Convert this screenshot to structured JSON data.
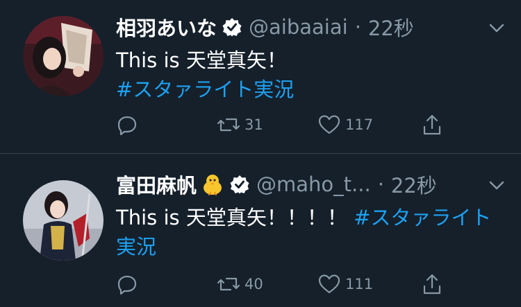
{
  "tweets": [
    {
      "name": "相羽あいな",
      "handle": "@aibaaiai",
      "separator": "·",
      "time": "22秒",
      "emoji": "",
      "text": "This is 天堂真矢！",
      "hashtag": "#スタァライト実況",
      "actions": {
        "reply": "",
        "retweet": "31",
        "like": "117"
      },
      "icons": [
        "reply-icon",
        "retweet-icon",
        "heart-icon",
        "share-icon",
        "verified-badge-icon",
        "chevron-down-icon"
      ]
    },
    {
      "name": "富田麻帆",
      "handle": "@maho_t...",
      "separator": "·",
      "time": "22秒",
      "emoji": "chick-emoji",
      "text": "This is 天堂真矢！！！！",
      "hashtag": "#スタァライト実況",
      "actions": {
        "reply": "",
        "retweet": "40",
        "like": "111"
      },
      "icons": [
        "reply-icon",
        "retweet-icon",
        "heart-icon",
        "share-icon",
        "verified-badge-icon",
        "chevron-down-icon"
      ]
    }
  ],
  "colors": {
    "background": "#15202b",
    "divider": "#38444d",
    "primary_text": "#ffffff",
    "secondary_text": "#8899a6",
    "hashtag": "#1da1f2"
  }
}
